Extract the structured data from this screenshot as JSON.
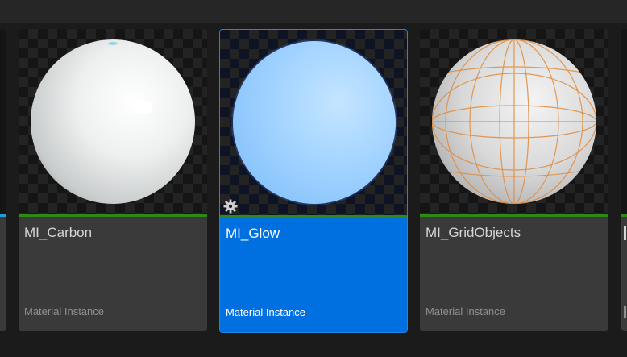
{
  "assets": [
    {
      "name": "MI_Carbon",
      "type": "Material Instance",
      "selected": false
    },
    {
      "name": "MI_Glow",
      "type": "Material Instance",
      "selected": true
    },
    {
      "name": "MI_GridObjects",
      "type": "Material Instance",
      "selected": false
    }
  ],
  "colors": {
    "selection": "#0070e0",
    "asset_type_accent": "#2b8a19",
    "tile_background": "#3a3a3a",
    "panel_background": "#1b1b1b"
  },
  "icons": {
    "selected_overlay": "gear-icon"
  }
}
